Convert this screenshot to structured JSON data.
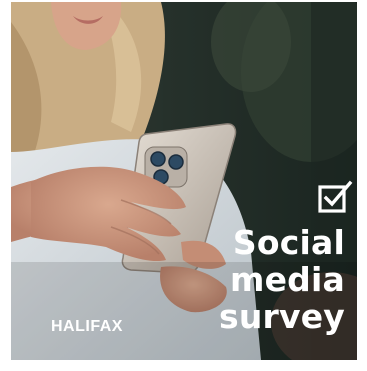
{
  "ad": {
    "headline_line1": "Social",
    "headline_line2": "media",
    "headline_line3": "survey",
    "brand": "HALIFAX",
    "icon": "checkbox-checked-icon",
    "colors": {
      "text": "#ffffff",
      "background_dark": "#1f2a24",
      "phone": "#c9c1b8"
    }
  }
}
